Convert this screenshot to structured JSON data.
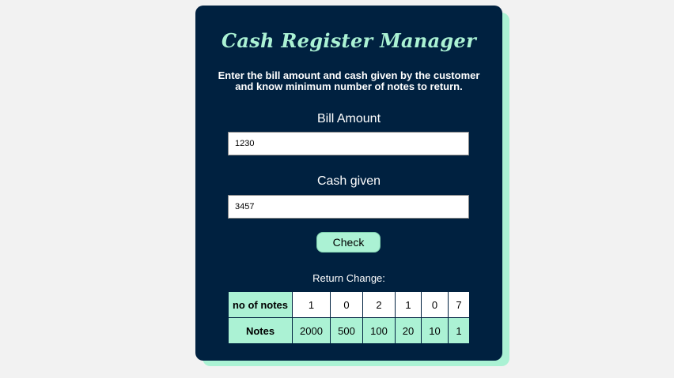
{
  "app": {
    "title": "Cash Register Manager",
    "description": "Enter the bill amount and cash given by the customer and know minimum number of notes to return."
  },
  "form": {
    "bill_label": "Bill Amount",
    "bill_value": "1230",
    "cash_label": "Cash given",
    "cash_value": "3457",
    "check_label": "Check"
  },
  "result": {
    "label": "Return Change:",
    "count_header": "no of notes",
    "notes_header": "Notes",
    "counts": [
      "1",
      "0",
      "2",
      "1",
      "0",
      "7"
    ],
    "notes": [
      "2000",
      "500",
      "100",
      "20",
      "10",
      "1"
    ]
  },
  "colors": {
    "card_bg": "#002140",
    "accent": "#abf2d4",
    "page_bg": "#f2f2f2"
  }
}
